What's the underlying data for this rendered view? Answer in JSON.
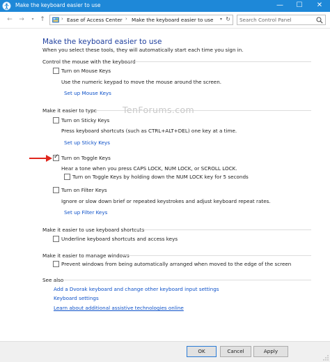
{
  "window": {
    "title": "Make the keyboard easier to use",
    "minimize": "—",
    "maximize": "☐",
    "close": "✕"
  },
  "nav": {
    "back": "←",
    "forward": "→",
    "recent": "▾",
    "up": "↑",
    "breadcrumb": [
      "Ease of Access Center",
      "Make the keyboard easier to use"
    ],
    "separator": "›",
    "dropdown": "▾",
    "refresh": "↻",
    "search_placeholder": "Search Control Panel"
  },
  "main": {
    "title": "Make the keyboard easier to use",
    "subtitle": "When you select these tools, they will automatically start each time you sign in."
  },
  "watermark": "TenForums.com",
  "sections": {
    "mouse": {
      "title": "Control the mouse with the keyboard",
      "mouse_keys_label": "Turn on Mouse Keys",
      "mouse_keys_checked": false,
      "mouse_keys_desc": "Use the numeric keypad to move the mouse around the screen.",
      "mouse_keys_link": "Set up Mouse Keys"
    },
    "typing": {
      "title": "Make it easier to type",
      "sticky_label": "Turn on Sticky Keys",
      "sticky_checked": false,
      "sticky_desc": "Press keyboard shortcuts (such as CTRL+ALT+DEL) one key at a time.",
      "sticky_link": "Set up Sticky Keys",
      "toggle_label": "Turn on Toggle Keys",
      "toggle_checked": true,
      "toggle_desc": "Hear a tone when you press CAPS LOCK, NUM LOCK, or SCROLL LOCK.",
      "toggle_hold_label": "Turn on Toggle Keys by holding down the NUM LOCK key for 5 seconds",
      "toggle_hold_checked": false,
      "filter_label": "Turn on Filter Keys",
      "filter_checked": false,
      "filter_desc": "Ignore or slow down brief or repeated keystrokes and adjust keyboard repeat rates.",
      "filter_link": "Set up Filter Keys"
    },
    "shortcuts": {
      "title": "Make it easier to use keyboard shortcuts",
      "underline_label": "Underline keyboard shortcuts and access keys",
      "underline_checked": false
    },
    "windows": {
      "title": "Make it easier to manage windows",
      "prevent_label": "Prevent windows from being automatically arranged when moved to the edge of the screen",
      "prevent_checked": false
    },
    "see_also": {
      "title": "See also",
      "links": [
        "Add a Dvorak keyboard and change other keyboard input settings",
        "Keyboard settings",
        "Learn about additional assistive technologies online"
      ]
    }
  },
  "footer": {
    "ok": "OK",
    "cancel": "Cancel",
    "apply": "Apply"
  },
  "colors": {
    "titlebar": "#1e88d8",
    "link": "#0d51c9",
    "heading": "#1f3f9e",
    "arrow": "#e0261d"
  }
}
